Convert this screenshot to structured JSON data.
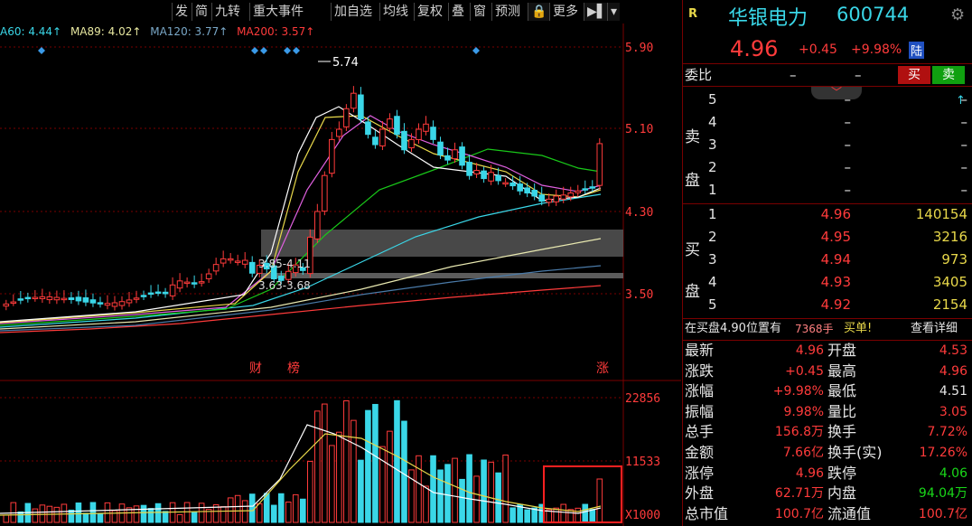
{
  "toolbar": {
    "buttons": [
      "发",
      "简",
      "九转",
      "重大事件",
      "加自选",
      "均线",
      "复权",
      "叠",
      "窗",
      "预测",
      "🔒",
      "更多",
      "▶▌",
      "▾"
    ]
  },
  "ma_legend": [
    {
      "label": "A60: 4.44↑",
      "color": "#3ad7e8"
    },
    {
      "label": "MA89: 4.02↑",
      "color": "#e8e8a0"
    },
    {
      "label": "MA120: 3.77↑",
      "color": "#7aa8c8"
    },
    {
      "label": "MA200: 3.57↑",
      "color": "#ff3b3b"
    }
  ],
  "chart": {
    "y_axis_labels": [
      "5.90",
      "5.10",
      "4.30",
      "3.50"
    ],
    "volume_axis_labels": [
      "22856",
      "11533",
      "X1000"
    ],
    "high_label": "5.74",
    "zone_labels": [
      "3.85-4.11",
      "3.63-3.68"
    ],
    "event_markers": [
      "财",
      "榜",
      "涨"
    ]
  },
  "stock": {
    "badge": "R",
    "name": "华银电力",
    "code": "600744",
    "price": "4.96",
    "change": "+0.45",
    "pct": "+9.98%",
    "market_badge": "陆"
  },
  "weibi": {
    "label": "委比",
    "v1": "–",
    "v2": "–",
    "v3": "–",
    "buy_btn": "买",
    "sell_btn": "卖"
  },
  "sell_book": {
    "side_label": [
      "卖",
      "盘"
    ],
    "levels": [
      {
        "n": "5",
        "p": "–",
        "v": "–"
      },
      {
        "n": "4",
        "p": "–",
        "v": "–"
      },
      {
        "n": "3",
        "p": "–",
        "v": "–"
      },
      {
        "n": "2",
        "p": "–",
        "v": "–"
      },
      {
        "n": "1",
        "p": "–",
        "v": "–"
      }
    ]
  },
  "buy_book": {
    "side_label": [
      "买",
      "盘"
    ],
    "levels": [
      {
        "n": "1",
        "p": "4.96",
        "v": "140154"
      },
      {
        "n": "2",
        "p": "4.95",
        "v": "3216"
      },
      {
        "n": "3",
        "p": "4.94",
        "v": "973"
      },
      {
        "n": "4",
        "p": "4.93",
        "v": "3405"
      },
      {
        "n": "5",
        "p": "4.92",
        "v": "2154"
      }
    ]
  },
  "notice": {
    "text1": "在买盘4.90位置有",
    "text2": "7368手",
    "text3": "买单!",
    "link": "查看详细"
  },
  "stats": [
    {
      "l1": "最新",
      "v1": "4.96",
      "c1": "red",
      "l2": "开盘",
      "v2": "4.53",
      "c2": "red"
    },
    {
      "l1": "涨跌",
      "v1": "+0.45",
      "c1": "red",
      "l2": "最高",
      "v2": "4.96",
      "c2": "red"
    },
    {
      "l1": "涨幅",
      "v1": "+9.98%",
      "c1": "red",
      "l2": "最低",
      "v2": "4.51",
      "c2": "white"
    },
    {
      "l1": "振幅",
      "v1": "9.98%",
      "c1": "red",
      "l2": "量比",
      "v2": "3.05",
      "c2": "red"
    },
    {
      "l1": "总手",
      "v1": "156.8万",
      "c1": "red",
      "l2": "换手",
      "v2": "7.72%",
      "c2": "red"
    },
    {
      "l1": "金额",
      "v1": "7.66亿",
      "c1": "red",
      "l2": "换手(实)",
      "v2": "17.26%",
      "c2": "red"
    },
    {
      "l1": "涨停",
      "v1": "4.96",
      "c1": "red",
      "l2": "跌停",
      "v2": "4.06",
      "c2": "green"
    },
    {
      "l1": "外盘",
      "v1": "62.71万",
      "c1": "red",
      "l2": "内盘",
      "v2": "94.04万",
      "c2": "green"
    },
    {
      "l1": "总市值",
      "v1": "100.7亿",
      "c1": "red",
      "l2": "流通值",
      "v2": "100.7亿",
      "c2": "red"
    }
  ],
  "colors": {
    "up": "#ff3b3b",
    "down": "#3ad7e8",
    "bg": "#000000",
    "grid": "#700000"
  }
}
